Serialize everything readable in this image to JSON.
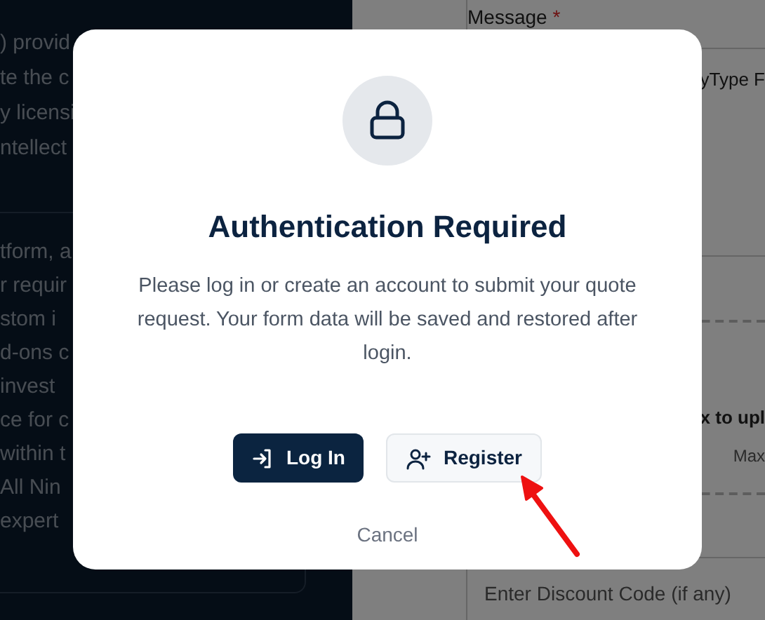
{
  "background": {
    "left_panel": {
      "intro_lines": [
        ") provid",
        "te the c",
        "y licensi",
        "ntellect"
      ],
      "card_lines": [
        "tform, a",
        "r requir",
        "stom i",
        "d-ons c",
        "invest",
        "ce for c",
        "within t",
        "All Nin",
        "expert"
      ]
    },
    "right_panel": {
      "message_label": "Message",
      "required_mark": "*",
      "message_fragment": "yType F",
      "upload_fragment": "x to upl",
      "size_fragment": "Max",
      "discount_placeholder": "Enter Discount Code (if any)"
    }
  },
  "dialog": {
    "title": "Authentication Required",
    "message": "Please log in or create an account to submit your quote request. Your form data will be saved and restored after login.",
    "buttons": [
      {
        "label": "Log In",
        "kind": "primary"
      },
      {
        "label": "Register",
        "kind": "secondary"
      }
    ],
    "cancel": "Cancel"
  }
}
